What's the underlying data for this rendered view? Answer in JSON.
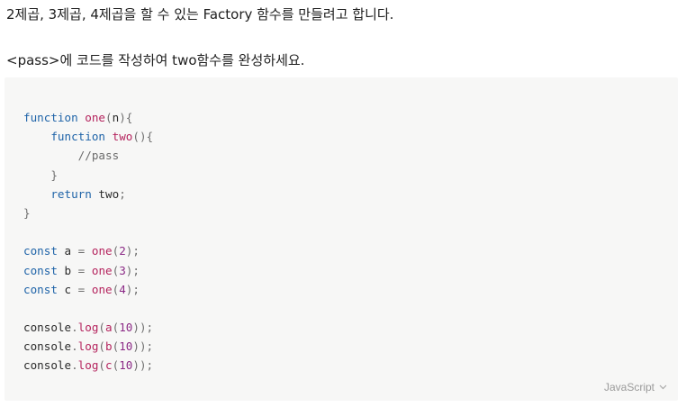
{
  "question": {
    "paragraph1": "2제곱, 3제곱, 4제곱을 할 수 있는 Factory 함수를 만들려고 합니다.",
    "paragraph2": "<pass>에 코드를 작성하여 two함수를 완성하세요."
  },
  "code_block": {
    "language_label": "JavaScript",
    "language_icon": "chevron-down-icon",
    "lines": [
      [
        {
          "t": "kw",
          "v": "function"
        },
        {
          "t": "id",
          "v": " "
        },
        {
          "t": "fn",
          "v": "one"
        },
        {
          "t": "pun",
          "v": "("
        },
        {
          "t": "id",
          "v": "n"
        },
        {
          "t": "pun",
          "v": "){"
        }
      ],
      [
        {
          "t": "id",
          "v": "    "
        },
        {
          "t": "kw",
          "v": "function"
        },
        {
          "t": "id",
          "v": " "
        },
        {
          "t": "fn",
          "v": "two"
        },
        {
          "t": "pun",
          "v": "(){"
        }
      ],
      [
        {
          "t": "com",
          "v": "        //pass"
        }
      ],
      [
        {
          "t": "pun",
          "v": "    }"
        }
      ],
      [
        {
          "t": "id",
          "v": "    "
        },
        {
          "t": "kw",
          "v": "return"
        },
        {
          "t": "id",
          "v": " two"
        },
        {
          "t": "pun",
          "v": ";"
        }
      ],
      [
        {
          "t": "pun",
          "v": "}"
        }
      ],
      [],
      [
        {
          "t": "kw",
          "v": "const"
        },
        {
          "t": "id",
          "v": " a "
        },
        {
          "t": "pun",
          "v": "="
        },
        {
          "t": "id",
          "v": " "
        },
        {
          "t": "fn",
          "v": "one"
        },
        {
          "t": "pun",
          "v": "("
        },
        {
          "t": "num",
          "v": "2"
        },
        {
          "t": "pun",
          "v": ");"
        }
      ],
      [
        {
          "t": "kw",
          "v": "const"
        },
        {
          "t": "id",
          "v": " b "
        },
        {
          "t": "pun",
          "v": "="
        },
        {
          "t": "id",
          "v": " "
        },
        {
          "t": "fn",
          "v": "one"
        },
        {
          "t": "pun",
          "v": "("
        },
        {
          "t": "num",
          "v": "3"
        },
        {
          "t": "pun",
          "v": ");"
        }
      ],
      [
        {
          "t": "kw",
          "v": "const"
        },
        {
          "t": "id",
          "v": " c "
        },
        {
          "t": "pun",
          "v": "="
        },
        {
          "t": "id",
          "v": " "
        },
        {
          "t": "fn",
          "v": "one"
        },
        {
          "t": "pun",
          "v": "("
        },
        {
          "t": "num",
          "v": "4"
        },
        {
          "t": "pun",
          "v": ");"
        }
      ],
      [],
      [
        {
          "t": "id",
          "v": "console"
        },
        {
          "t": "pun",
          "v": "."
        },
        {
          "t": "fn",
          "v": "log"
        },
        {
          "t": "pun",
          "v": "("
        },
        {
          "t": "fn",
          "v": "a"
        },
        {
          "t": "pun",
          "v": "("
        },
        {
          "t": "num",
          "v": "10"
        },
        {
          "t": "pun",
          "v": "));"
        }
      ],
      [
        {
          "t": "id",
          "v": "console"
        },
        {
          "t": "pun",
          "v": "."
        },
        {
          "t": "fn",
          "v": "log"
        },
        {
          "t": "pun",
          "v": "("
        },
        {
          "t": "fn",
          "v": "b"
        },
        {
          "t": "pun",
          "v": "("
        },
        {
          "t": "num",
          "v": "10"
        },
        {
          "t": "pun",
          "v": "));"
        }
      ],
      [
        {
          "t": "id",
          "v": "console"
        },
        {
          "t": "pun",
          "v": "."
        },
        {
          "t": "fn",
          "v": "log"
        },
        {
          "t": "pun",
          "v": "("
        },
        {
          "t": "fn",
          "v": "c"
        },
        {
          "t": "pun",
          "v": "("
        },
        {
          "t": "num",
          "v": "10"
        },
        {
          "t": "pun",
          "v": "));"
        }
      ]
    ]
  }
}
